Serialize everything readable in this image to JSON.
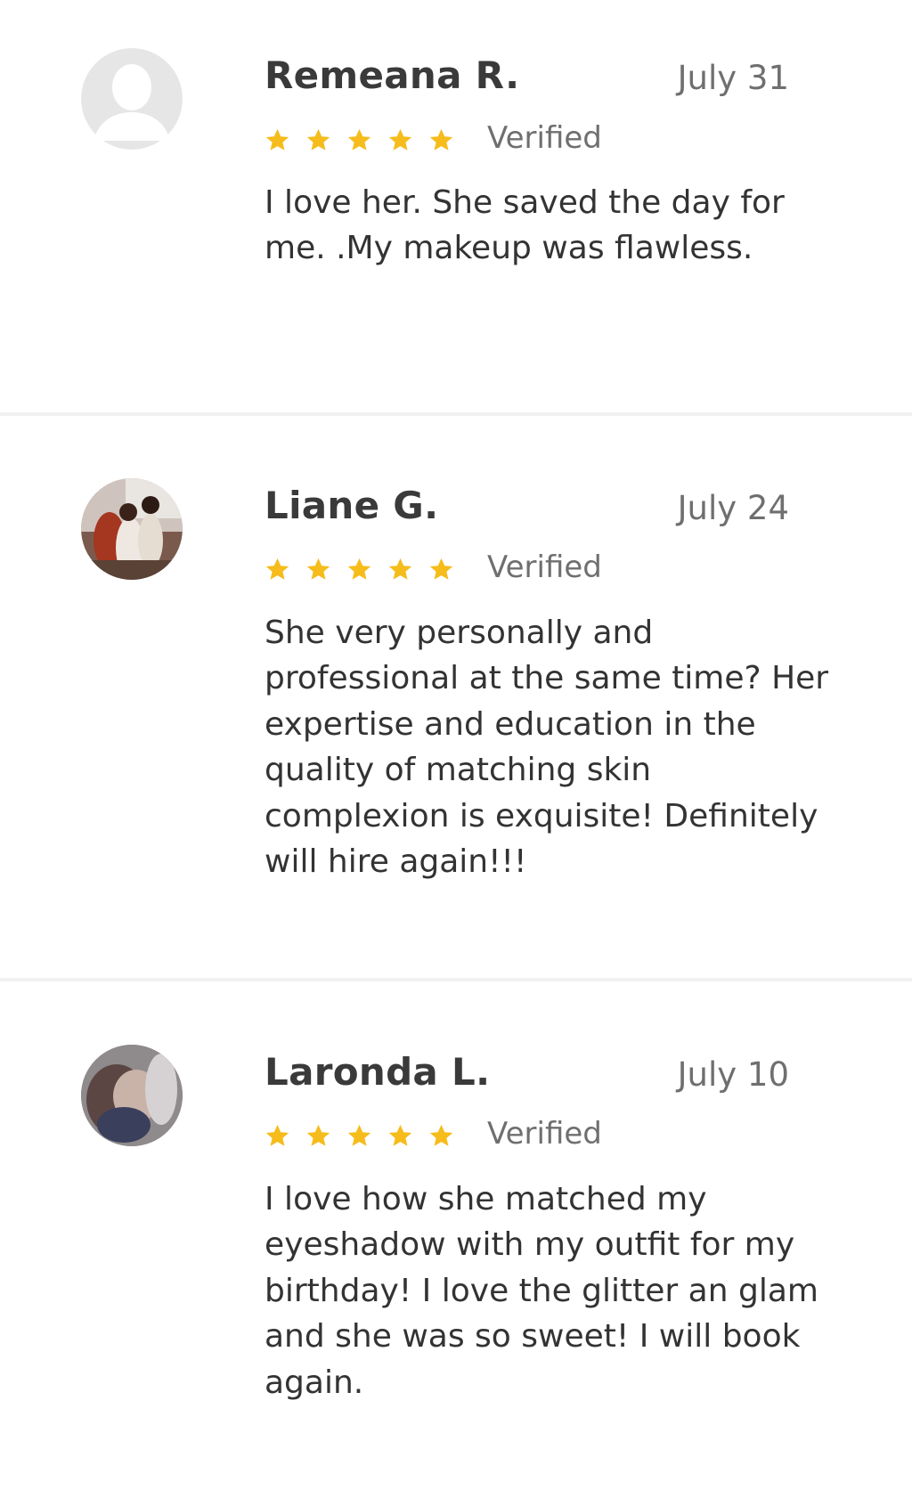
{
  "colors": {
    "star": "#f5bc1b",
    "name": "#3a3a3a",
    "meta": "#6f6f6f",
    "body": "#333333",
    "divider": "#f1f1f1"
  },
  "reviews": [
    {
      "name": "Remeana R.",
      "date": "July 31",
      "rating": 5,
      "status": "Verified",
      "avatar_icon": "default-user-avatar-icon",
      "text": "I love her. She saved the day for me. .My makeup was flawless."
    },
    {
      "name": "Liane G.",
      "date": "July 24",
      "rating": 5,
      "status": "Verified",
      "avatar_icon": "user-photo-avatar",
      "text": "She very personally and professional at the same time? Her expertise and education in the quality of matching skin complexion is exquisite! Definitely will hire again!!!"
    },
    {
      "name": "Laronda L.",
      "date": "July 10",
      "rating": 5,
      "status": "Verified",
      "avatar_icon": "user-photo-avatar",
      "text": "I love how she matched my eyeshadow with my outfit for my birthday! I love the glitter an glam and she was so sweet! I will book again."
    }
  ]
}
